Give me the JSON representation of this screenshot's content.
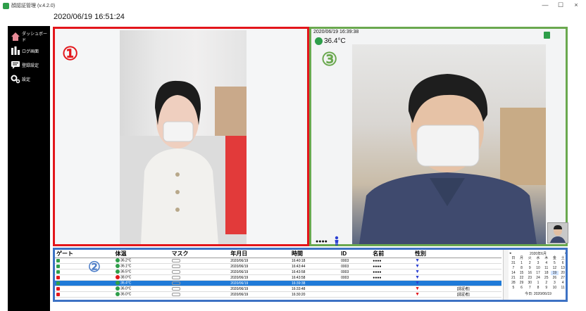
{
  "window": {
    "app_title": "顔認証管理 (v.4.2.0)",
    "controls": {
      "minimize": "—",
      "maximize": "☐",
      "close": "×"
    }
  },
  "header": {
    "datetime": "2020/06/19 16:51:24"
  },
  "sidebar": {
    "items": [
      {
        "label": "ダッシュボード",
        "icon": "home-icon"
      },
      {
        "label": "ログ画面",
        "icon": "bar-chart-icon"
      },
      {
        "label": "登録設定",
        "icon": "message-icon"
      },
      {
        "label": "設定",
        "icon": "gear-icon"
      }
    ]
  },
  "panel1": {
    "marker": "①",
    "color": "#e3161b"
  },
  "panel3": {
    "marker": "③",
    "color": "#6aa84f",
    "timestamp": "2020/06/19 16:39:38",
    "temperature": "36.4°C",
    "name": "●●●●"
  },
  "table_panel": {
    "marker": "②",
    "color": "#3d72c4",
    "columns": [
      "ゲート",
      "体温",
      "マスク",
      "年月日",
      "時間",
      "ID",
      "名前",
      "性別"
    ],
    "rows": [
      {
        "gate": "open",
        "status": "green",
        "temp": "36.2°C",
        "date": "2020/06/19",
        "time": "16:40:18",
        "id": "0003",
        "name": "●●●●",
        "gender": "male",
        "note": ""
      },
      {
        "gate": "open",
        "status": "green",
        "temp": "36.1°C",
        "date": "2020/06/19",
        "time": "16:43:44",
        "id": "0003",
        "name": "●●●●",
        "gender": "male",
        "note": ""
      },
      {
        "gate": "open",
        "status": "green",
        "temp": "36.5°C",
        "date": "2020/06/19",
        "time": "16:43:58",
        "id": "0003",
        "name": "●●●●",
        "gender": "male",
        "note": ""
      },
      {
        "gate": "closed",
        "status": "red",
        "temp": "38.0°C",
        "date": "2020/06/19",
        "time": "16:43:58",
        "id": "0003",
        "name": "●●●●",
        "gender": "male",
        "note": ""
      },
      {
        "gate": "open",
        "status": "green",
        "temp": "36.4°C",
        "date": "2020/06/19",
        "time": "16:39:38",
        "id": "",
        "name": "",
        "gender": "male",
        "note": "",
        "selected": true
      },
      {
        "gate": "closed",
        "status": "green",
        "temp": "36.0°C",
        "date": "2020/06/19",
        "time": "16:33:48",
        "id": "",
        "name": "",
        "gender": "female",
        "note": "[認証者]"
      },
      {
        "gate": "closed",
        "status": "green",
        "temp": "36.0°C",
        "date": "2020/06/19",
        "time": "16:30:20",
        "id": "",
        "name": "",
        "gender": "female",
        "note": "[認証者]"
      }
    ]
  },
  "calendar": {
    "title": "2020年6月",
    "prev": "◂",
    "next": "▸",
    "weekdays": [
      "日",
      "月",
      "火",
      "水",
      "木",
      "金",
      "土"
    ],
    "days": [
      "31",
      "1",
      "2",
      "3",
      "4",
      "5",
      "6",
      "7",
      "8",
      "9",
      "10",
      "11",
      "12",
      "13",
      "14",
      "15",
      "16",
      "17",
      "18",
      "19",
      "20",
      "21",
      "22",
      "23",
      "24",
      "25",
      "26",
      "27",
      "28",
      "29",
      "30",
      "1",
      "2",
      "3",
      "4",
      "5",
      "6",
      "7",
      "8",
      "9",
      "10",
      "11"
    ],
    "highlighted": "19",
    "today_label": "今日: 2020/06/19"
  }
}
